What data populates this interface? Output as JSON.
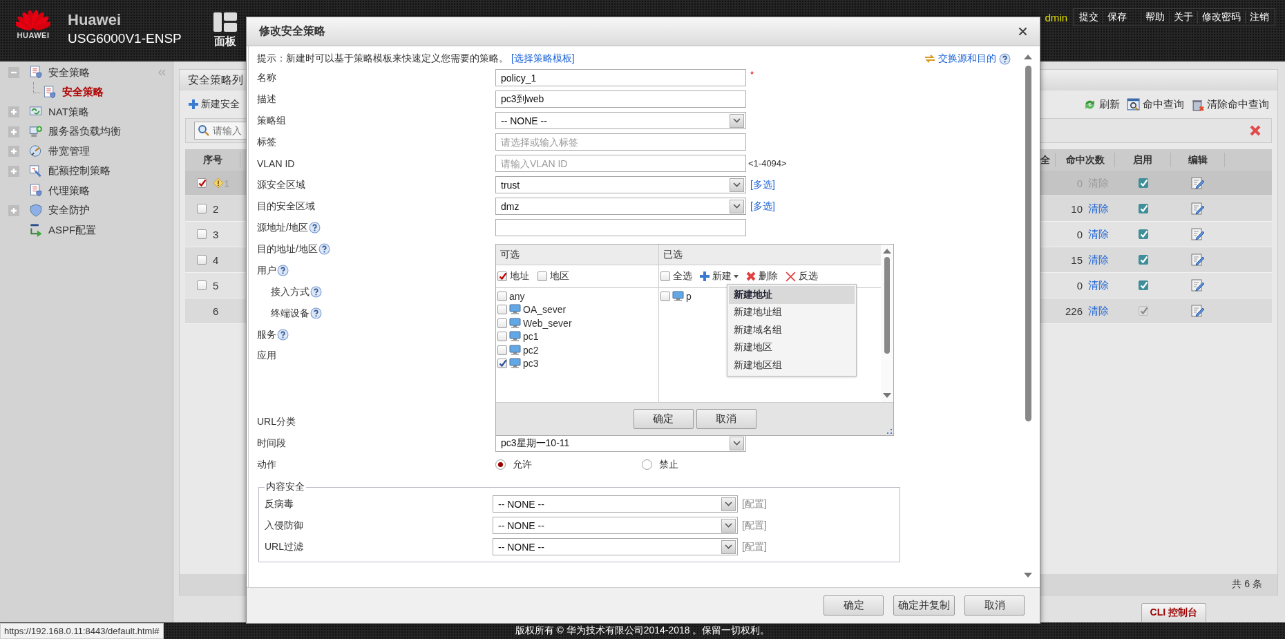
{
  "header": {
    "logo_text": "HUAWEI",
    "brand": "Huawei",
    "model": "USG6000V1-ENSP",
    "nav_tab": "面板",
    "user": "dmin",
    "actions": [
      "提交",
      "保存"
    ],
    "links": [
      "帮助",
      "关于",
      "修改密码",
      "注销"
    ]
  },
  "sidebar": {
    "items": [
      {
        "label": "安全策略",
        "kind": "doc",
        "expanded": true,
        "selected": false,
        "children": [
          {
            "label": "安全策略",
            "kind": "doc",
            "selected": true
          }
        ]
      },
      {
        "label": "NAT策略",
        "kind": "nat",
        "expanded": false,
        "selected": false
      },
      {
        "label": "服务器负载均衡",
        "kind": "server",
        "expanded": false,
        "selected": false
      },
      {
        "label": "带宽管理",
        "kind": "bandwidth",
        "expanded": false,
        "selected": false
      },
      {
        "label": "配额控制策略",
        "kind": "quota",
        "expanded": false,
        "selected": false
      },
      {
        "label": "代理策略",
        "kind": "doc",
        "selected": false
      },
      {
        "label": "安全防护",
        "kind": "shield",
        "expanded": false,
        "selected": false
      },
      {
        "label": "ASPF配置",
        "kind": "aspf",
        "selected": false
      }
    ]
  },
  "policy_list": {
    "title": "安全策略列",
    "new_button": "新建安全",
    "tools": [
      {
        "label": "刷新",
        "kind": "refresh"
      },
      {
        "label": "命中查询",
        "kind": "query"
      },
      {
        "label": "清除命中查询",
        "kind": "clear"
      }
    ],
    "search": {
      "placeholder": "请输入"
    },
    "table": {
      "columns": [
        "序号",
        "全",
        "命中次数",
        "启用",
        "编辑"
      ],
      "rows": [
        {
          "kind": "policy",
          "number": "1",
          "checked": true,
          "selected": true,
          "warning": true,
          "hits": "0",
          "clear": "清除",
          "clear_disabled": true,
          "enabled": true,
          "enabled_disabled": false
        },
        {
          "kind": "policy",
          "number": "2",
          "checked": false,
          "selected": false,
          "warning": false,
          "hits": "10",
          "clear": "清除",
          "clear_disabled": false,
          "enabled": true,
          "enabled_disabled": false
        },
        {
          "kind": "policy",
          "number": "3",
          "checked": false,
          "selected": false,
          "warning": false,
          "hits": "0",
          "clear": "清除",
          "clear_disabled": false,
          "enabled": true,
          "enabled_disabled": false
        },
        {
          "kind": "policy",
          "number": "4",
          "checked": false,
          "selected": false,
          "warning": false,
          "hits": "15",
          "clear": "清除",
          "clear_disabled": false,
          "enabled": true,
          "enabled_disabled": false
        },
        {
          "kind": "policy",
          "number": "5",
          "checked": false,
          "selected": false,
          "warning": false,
          "hits": "0",
          "clear": "清除",
          "clear_disabled": false,
          "enabled": true,
          "enabled_disabled": false
        },
        {
          "kind": "default",
          "number": "6",
          "selected": false,
          "warning": false,
          "hits": "226",
          "clear": "清除",
          "clear_disabled": false,
          "enabled": true,
          "enabled_disabled": true
        }
      ]
    },
    "count": "共 6 条",
    "cli_tab": "CLI 控制台"
  },
  "dialog": {
    "title": "修改安全策略",
    "hint": "提示：新建时可以基于策略模板来快速定义您需要的策略。",
    "template_link": "[选择策略模板]",
    "swap_link": "交换源和目的",
    "rows": [
      {
        "label": "名称",
        "kind": "input",
        "value": "policy_1",
        "required_mark": "*"
      },
      {
        "label": "描述",
        "kind": "input",
        "value": "pc3到web"
      },
      {
        "label": "策略组",
        "kind": "select",
        "value": "-- NONE --"
      },
      {
        "label": "标签",
        "kind": "input",
        "placeholder": "请选择或输入标签"
      },
      {
        "label": "VLAN ID",
        "kind": "input",
        "placeholder": "请输入VLAN ID",
        "note": "<1-4094>"
      },
      {
        "label": "源安全区域",
        "kind": "select",
        "value": "trust",
        "link": "[多选]"
      },
      {
        "label": "目的安全区域",
        "kind": "select",
        "value": "dmz",
        "link": "[多选]"
      },
      {
        "label": "源地址/地区",
        "kind": "input",
        "help": true
      },
      {
        "label": "目的地址/地区",
        "kind": "label",
        "help": true
      },
      {
        "label": "用户",
        "kind": "label",
        "help": true,
        "children": [
          {
            "label": "接入方式",
            "help": true
          },
          {
            "label": "终端设备",
            "help": true
          }
        ]
      },
      {
        "label": "服务",
        "kind": "label",
        "help": true
      },
      {
        "label": "应用",
        "kind": "area"
      },
      {
        "label": "URL分类",
        "kind": "label"
      },
      {
        "label": "时间段",
        "kind": "select",
        "value": "pc3星期一10-11"
      },
      {
        "label": "动作",
        "kind": "radio",
        "options": [
          {
            "label": "允许",
            "selected": true
          },
          {
            "label": "禁止",
            "selected": false
          }
        ]
      }
    ],
    "content_security": {
      "title": "内容安全",
      "rows": [
        {
          "label": "反病毒",
          "value": "-- NONE --",
          "link": "[配置]"
        },
        {
          "label": "入侵防御",
          "value": "-- NONE --",
          "link": "[配置]"
        },
        {
          "label": "URL过滤",
          "value": "-- NONE --",
          "link": "[配置]"
        }
      ]
    },
    "picker": {
      "available_title": "可选",
      "selected_title": "已选",
      "filters": [
        {
          "label": "地址",
          "checked": true
        },
        {
          "label": "地区",
          "checked": false
        }
      ],
      "select_all": {
        "label": "全选",
        "checked": false
      },
      "actions": [
        {
          "label": "新建",
          "kind": "new"
        },
        {
          "label": "删除",
          "kind": "delete"
        },
        {
          "label": "反选",
          "kind": "invert"
        }
      ],
      "available": [
        {
          "label": "any",
          "kind": "plain",
          "checked": false
        },
        {
          "label": "OA_sever",
          "kind": "host",
          "checked": false
        },
        {
          "label": "Web_sever",
          "kind": "host",
          "checked": false
        },
        {
          "label": "pc1",
          "kind": "host",
          "checked": false
        },
        {
          "label": "pc2",
          "kind": "host",
          "checked": false
        },
        {
          "label": "pc3",
          "kind": "host",
          "checked": true
        }
      ],
      "chosen": [
        {
          "label": "p",
          "kind": "host",
          "checked": false
        }
      ],
      "menu": [
        {
          "label": "新建地址",
          "selected": true
        },
        {
          "label": "新建地址组",
          "selected": false
        },
        {
          "label": "新建域名组",
          "selected": false
        },
        {
          "label": "新建地区",
          "selected": false
        },
        {
          "label": "新建地区组",
          "selected": false
        }
      ],
      "buttons": [
        "确定",
        "取消"
      ]
    },
    "buttons": [
      "确定",
      "确定并复制",
      "取消"
    ]
  },
  "status_url": "https://192.168.0.11:8443/default.html#",
  "copyright": "版权所有 © 华为技术有限公司2014-2018 。保留一切权利。"
}
